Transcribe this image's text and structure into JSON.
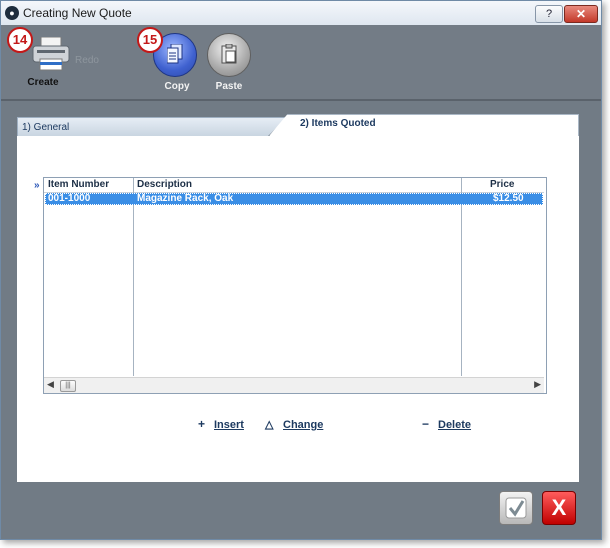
{
  "window": {
    "title": "Creating New Quote",
    "help_label": "?",
    "close_label": "✕"
  },
  "toolbar": {
    "create_label": "Create",
    "redo_label": "Redo",
    "copy_label": "Copy",
    "paste_label": "Paste",
    "badge_create": "14",
    "badge_copy": "15"
  },
  "tabs": [
    {
      "label": "1) General"
    },
    {
      "label": "2) Items Quoted"
    }
  ],
  "table": {
    "row_marker": "»",
    "columns": [
      "Item Number",
      "Description",
      "Price"
    ],
    "rows": [
      {
        "item_number": "001-1000",
        "description": "Magazine Rack, Oak",
        "price": "$12.50"
      }
    ]
  },
  "actions": {
    "insert_icon": "+",
    "insert_label": "Insert",
    "change_icon": "△",
    "change_label": "Change",
    "delete_icon": "−",
    "delete_label": "Delete"
  },
  "dialog": {
    "cancel_label": "X"
  },
  "icons": {
    "app": "quote-app-icon",
    "create": "printer-icon",
    "copy": "copy-icon",
    "paste": "paste-icon",
    "ok": "checkmark-icon",
    "cancel": "x-cancel-icon"
  },
  "colors": {
    "selection": "#3a8ee6",
    "toolbar_bg": "#737c86",
    "accent_red": "#c31818"
  }
}
